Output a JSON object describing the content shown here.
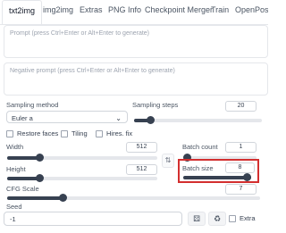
{
  "tabs": [
    "txt2img",
    "img2img",
    "Extras",
    "PNG Info",
    "Checkpoint Merger",
    "Train",
    "OpenPose E"
  ],
  "prompt": {
    "placeholder": "Prompt (press Ctrl+Enter or Alt+Enter to generate)"
  },
  "negative_prompt": {
    "placeholder": "Negative prompt (press Ctrl+Enter or Alt+Enter to generate)"
  },
  "sampling_method": {
    "label": "Sampling method",
    "value": "Euler a"
  },
  "sampling_steps": {
    "label": "Sampling steps",
    "value": "20",
    "fraction": 0.13
  },
  "checkboxes": {
    "restore_faces": "Restore faces",
    "tiling": "Tiling",
    "hires_fix": "Hires. fix"
  },
  "width": {
    "label": "Width",
    "value": "512",
    "fraction": 0.22
  },
  "height": {
    "label": "Height",
    "value": "512",
    "fraction": 0.22
  },
  "batch_count": {
    "label": "Batch count",
    "value": "1",
    "fraction": 0.0
  },
  "batch_size": {
    "label": "Batch size",
    "value": "8",
    "fraction": 1.0
  },
  "cfg_scale": {
    "label": "CFG Scale",
    "value": "7",
    "fraction": 0.22
  },
  "seed": {
    "label": "Seed",
    "value": "-1"
  },
  "extra": {
    "label": "Extra"
  },
  "icons": {
    "swap": "swap-arrows-icon",
    "dice": "dice-icon",
    "recycle": "recycle-icon",
    "dropdown": "chevron-down-icon"
  },
  "colors": {
    "highlight": "#d32f2f",
    "slider": "#374151"
  }
}
